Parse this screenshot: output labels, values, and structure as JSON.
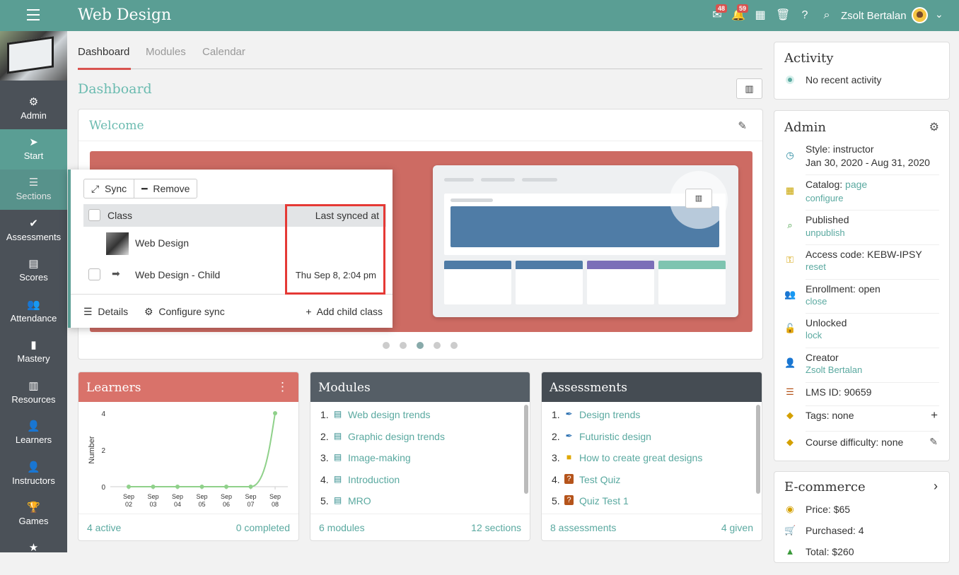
{
  "header": {
    "title": "Web Design",
    "mail_badge": "48",
    "notif_badge": "59",
    "username": "Zsolt Bertalan"
  },
  "sidebar": {
    "items": [
      {
        "label": "Admin",
        "icon": "⚙"
      },
      {
        "label": "Start",
        "icon": "➤"
      },
      {
        "label": "Sections",
        "icon": "☰"
      },
      {
        "label": "Assessments",
        "icon": "✔"
      },
      {
        "label": "Scores",
        "icon": "▤"
      },
      {
        "label": "Attendance",
        "icon": "👥"
      },
      {
        "label": "Mastery",
        "icon": "▮"
      },
      {
        "label": "Resources",
        "icon": "▥"
      },
      {
        "label": "Learners",
        "icon": "👤"
      },
      {
        "label": "Instructors",
        "icon": "👤"
      },
      {
        "label": "Games",
        "icon": "🏆"
      },
      {
        "label": "",
        "icon": "★"
      }
    ]
  },
  "tabs": [
    "Dashboard",
    "Modules",
    "Calendar"
  ],
  "page_title": "Dashboard",
  "welcome": {
    "title": "Welcome"
  },
  "sync_popup": {
    "sync_label": "Sync",
    "remove_label": "Remove",
    "col_class": "Class",
    "col_last_synced": "Last synced at",
    "rows": [
      {
        "name": "Web Design",
        "synced": ""
      },
      {
        "name": "Web Design - Child",
        "synced": "Thu Sep 8, 2:04 pm"
      }
    ],
    "details_label": "Details",
    "configure_label": "Configure sync",
    "add_child_label": "Add child class"
  },
  "learners": {
    "title": "Learners",
    "active": "4 active",
    "completed": "0 completed"
  },
  "chart_data": {
    "type": "line",
    "categories": [
      "Sep 02",
      "Sep 03",
      "Sep 04",
      "Sep 05",
      "Sep 06",
      "Sep 07",
      "Sep 08"
    ],
    "tick_top": [
      "Sep",
      "Sep",
      "Sep",
      "Sep",
      "Sep",
      "Sep",
      "Sep"
    ],
    "tick_bottom": [
      "02",
      "03",
      "04",
      "05",
      "06",
      "07",
      "08"
    ],
    "values": [
      0,
      0,
      0,
      0,
      0,
      0,
      4
    ],
    "ylabel": "Number",
    "yticks": [
      "0",
      "2",
      "4"
    ],
    "ylim": [
      0,
      4
    ]
  },
  "modules": {
    "title": "Modules",
    "items": [
      "Web design trends",
      "Graphic design trends",
      "Image-making",
      "Introduction",
      "MRO"
    ],
    "count": "6 modules",
    "sections": "12 sections"
  },
  "assessments": {
    "title": "Assessments",
    "items": [
      "Design trends",
      "Futuristic design",
      "How to create great designs",
      "Test Quiz",
      "Quiz Test 1"
    ],
    "count": "8 assessments",
    "given": "4 given"
  },
  "activity": {
    "title": "Activity",
    "text": "No recent activity"
  },
  "admin": {
    "title": "Admin",
    "style": "Style: instructor",
    "dates": "Jan 30, 2020 - Aug 31, 2020",
    "catalog": "Catalog:",
    "catalog_link": "page",
    "configure": "configure",
    "published": "Published",
    "unpublish": "unpublish",
    "access": "Access code: KEBW-IPSY",
    "reset": "reset",
    "enrollment": "Enrollment: open",
    "close": "close",
    "unlocked": "Unlocked",
    "lock": "lock",
    "creator": "Creator",
    "creator_name": "Zsolt Bertalan",
    "lms": "LMS ID: 90659",
    "tags": "Tags: none",
    "difficulty": "Course difficulty: none"
  },
  "ecommerce": {
    "title": "E-commerce",
    "price": "Price: $65",
    "purchased": "Purchased: 4",
    "total": "Total: $260"
  },
  "colors": {
    "teal": "#5a9e94",
    "link": "#5aa9a0",
    "learners": "#d9726a",
    "modules": "#555e66",
    "assessments": "#454c53",
    "alert": "#e53935"
  }
}
